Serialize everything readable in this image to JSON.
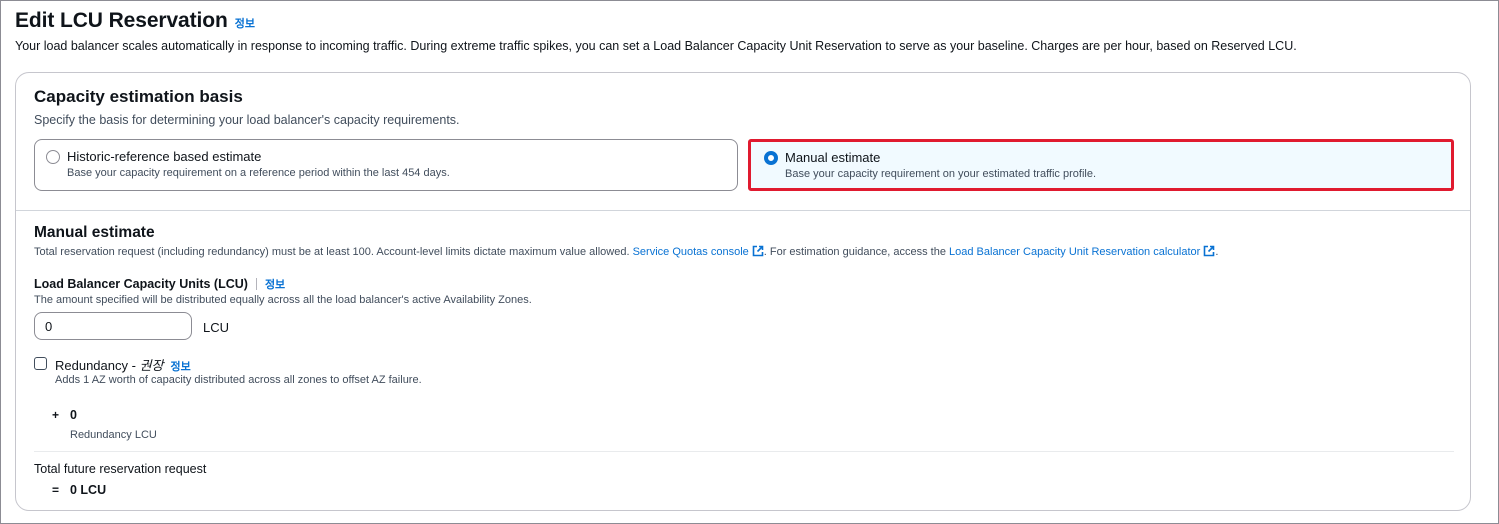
{
  "header": {
    "title": "Edit LCU Reservation",
    "info": "정보",
    "description": "Your load balancer scales automatically in response to incoming traffic. During extreme traffic spikes, you can set a Load Balancer Capacity Unit Reservation to serve as your baseline. Charges are per hour, based on Reserved LCU."
  },
  "basis": {
    "title": "Capacity estimation basis",
    "description": "Specify the basis for determining your load balancer's capacity requirements.",
    "options": [
      {
        "label": "Historic-reference based estimate",
        "description": "Base your capacity requirement on a reference period within the last 454 days.",
        "selected": false
      },
      {
        "label": "Manual estimate",
        "description": "Base your capacity requirement on your estimated traffic profile.",
        "selected": true
      }
    ]
  },
  "manual": {
    "title": "Manual estimate",
    "desc_part1": "Total reservation request (including redundancy) must be at least 100. Account-level limits dictate maximum value allowed. ",
    "quotas_link": "Service Quotas console",
    "desc_part2": ". For estimation guidance, access the ",
    "calc_link": "Load Balancer Capacity Unit Reservation calculator",
    "desc_part3": ".",
    "lcu_label": "Load Balancer Capacity Units (LCU)",
    "lcu_info": "정보",
    "lcu_desc": "The amount specified will be distributed equally across all the load balancer's active Availability Zones.",
    "lcu_value": "0",
    "lcu_unit": "LCU",
    "redundancy_label": "Redundancy - ",
    "redundancy_recommended": "권장",
    "redundancy_info": "정보",
    "redundancy_desc": "Adds 1 AZ worth of capacity distributed across all zones to offset AZ failure.",
    "redundancy_checked": false,
    "plus_sign": "+",
    "redundancy_value": "0",
    "redundancy_lcu_label": "Redundancy LCU",
    "total_label": "Total future reservation request",
    "equals_sign": "=",
    "total_value": "0 LCU"
  },
  "colors": {
    "accent": "#0972d3",
    "highlight_border": "#e01a2f",
    "selected_bg": "#f1faff"
  }
}
